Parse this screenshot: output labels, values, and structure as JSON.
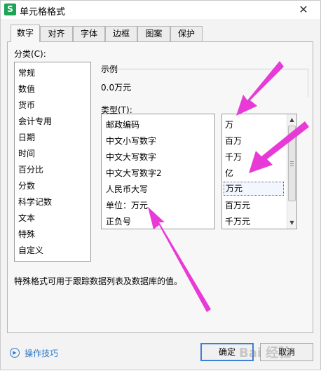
{
  "window": {
    "title": "单元格格式",
    "app_icon_glyph": "S"
  },
  "tabs": [
    {
      "label": "数字",
      "active": true
    },
    {
      "label": "对齐"
    },
    {
      "label": "字体"
    },
    {
      "label": "边框"
    },
    {
      "label": "图案"
    },
    {
      "label": "保护"
    }
  ],
  "category": {
    "label": "分类(C):",
    "items": [
      "常规",
      "数值",
      "货币",
      "会计专用",
      "日期",
      "时间",
      "百分比",
      "分数",
      "科学记数",
      "文本",
      "特殊",
      "自定义"
    ]
  },
  "sample": {
    "label": "示例",
    "value": "0.0万元"
  },
  "type_list": {
    "label": "类型(T):",
    "items": [
      "邮政编码",
      "中文小写数字",
      "中文大写数字",
      "中文大写数字2",
      "人民币大写",
      "单位：万元",
      "正负号"
    ]
  },
  "unit_list": {
    "items": [
      "万",
      "百万",
      "千万",
      "亿",
      "万元",
      "百万元",
      "千万元"
    ],
    "selected": "万元"
  },
  "description": "特殊格式可用于跟踪数据列表及数据库的值。",
  "footer": {
    "help_link": "操作技巧",
    "ok_button": "确定",
    "cancel_button": "取消"
  },
  "annotation_color": "#e83ad6"
}
